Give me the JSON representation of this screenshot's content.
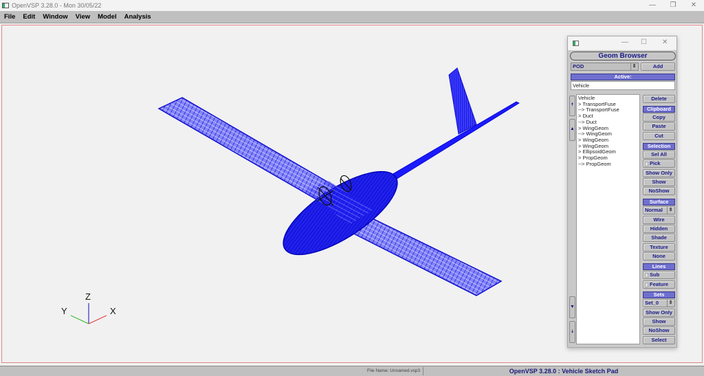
{
  "window": {
    "title": "OpenVSP 3.28.0 - Mon 30/05/22",
    "controls": {
      "minimize": "—",
      "restore": "❐",
      "close": "✕"
    }
  },
  "menubar": {
    "items": [
      "File",
      "Edit",
      "Window",
      "View",
      "Model",
      "Analysis"
    ]
  },
  "viewport": {
    "model": "wireframe aircraft",
    "wire_color": "#1a1aff",
    "axis_triad": {
      "labels": {
        "x": "X",
        "y": "Y",
        "z": "Z"
      },
      "colors": {
        "x": "#e04040",
        "y": "#40c040",
        "z": "#3030c0"
      }
    }
  },
  "geom_browser": {
    "window_controls": {
      "minimize": "—",
      "maximize": "☐",
      "close": "✕"
    },
    "title": "Geom Browser",
    "type_select": "POD",
    "add_label": "Add",
    "active_header": "Active:",
    "active_value": "Vehicle",
    "geoms": [
      "Vehicle",
      "> TransportFuse",
      "--> TransportFuse",
      "> Duct",
      "--> Duct",
      "> WingGeom",
      "--> WingGeom",
      "> WingGeom",
      "> WingGeom",
      "> EllipsoidGeom",
      "> PropGeom",
      "--> PropGeom"
    ],
    "scroll": {
      "top": "⯭",
      "up": "▲",
      "down": "▼",
      "bottom": "⯯"
    },
    "delete_label": "Delete",
    "clipboard": {
      "header": "Clipboard",
      "copy": "Copy",
      "paste": "Paste",
      "cut": "Cut"
    },
    "selection": {
      "header": "Selection",
      "sel_all": "Sel All",
      "pick": "Pick",
      "show_only": "Show Only",
      "show": "Show",
      "noshow": "NoShow"
    },
    "surface": {
      "header": "Surface",
      "mode": "Normal",
      "wire": "Wire",
      "hidden": "Hidden",
      "shade": "Shade",
      "texture": "Texture",
      "none": "None"
    },
    "lines": {
      "header": "Lines",
      "sub": "Sub",
      "feature": "Feature"
    },
    "sets": {
      "header": "Sets",
      "set": "Set_0",
      "show_only": "Show Only",
      "show": "Show",
      "noshow": "NoShow",
      "select": "Select"
    }
  },
  "statusbar": {
    "file_name": "File Name: Unnamed.vsp3",
    "app_name": "OpenVSP 3.28.0 : Vehicle Sketch Pad"
  }
}
